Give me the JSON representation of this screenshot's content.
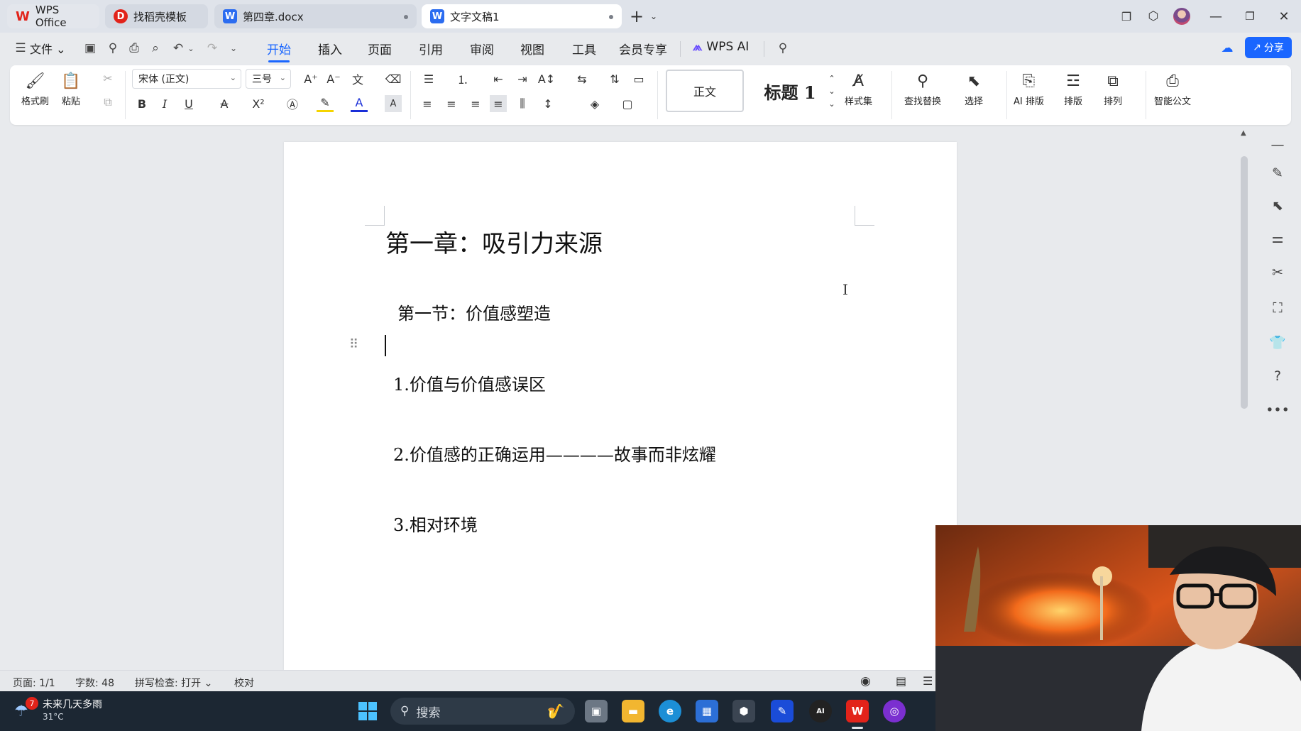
{
  "tabs": [
    {
      "label": "WPS Office",
      "icon": "wps-logo-icon"
    },
    {
      "label": "找稻壳模板",
      "icon": "docer-icon"
    },
    {
      "label": "第四章.docx",
      "icon": "word-doc-icon"
    },
    {
      "label": "文字文稿1",
      "icon": "word-doc-icon"
    }
  ],
  "menu": {
    "file": "文件",
    "tabs": [
      "开始",
      "插入",
      "页面",
      "引用",
      "审阅",
      "视图",
      "工具",
      "会员专享"
    ],
    "wps_ai": "WPS AI",
    "share": "分享"
  },
  "ribbon": {
    "format_painter": "格式刷",
    "paste": "粘贴",
    "font_name": "宋体 (正文)",
    "font_size": "三号",
    "style_body": "正文",
    "style_heading": "标题 1",
    "style_set": "样式集",
    "find_replace": "查找替换",
    "select": "选择",
    "ai_layout": "AI 排版",
    "layout": "排版",
    "arrange": "排列",
    "smart_doc": "智能公文"
  },
  "document": {
    "title": "第一章：吸引力来源",
    "section": "第一节：价值感塑造",
    "items": [
      "1.价值与价值感误区",
      "2.价值感的正确运用————故事而非炫耀",
      "3.相对环境"
    ]
  },
  "status": {
    "page": "页面: 1/1",
    "words": "字数: 48",
    "spell": "拼写检查: 打开",
    "proof": "校对"
  },
  "taskbar": {
    "weather_text": "未来几天多雨",
    "temperature": "31°C",
    "weather_badge": "7",
    "search": "搜索"
  },
  "colors": {
    "accent": "#1a66ff",
    "wps_red": "#e2231a",
    "word_blue": "#2b6cf0",
    "taskbar": "#1c2733"
  }
}
